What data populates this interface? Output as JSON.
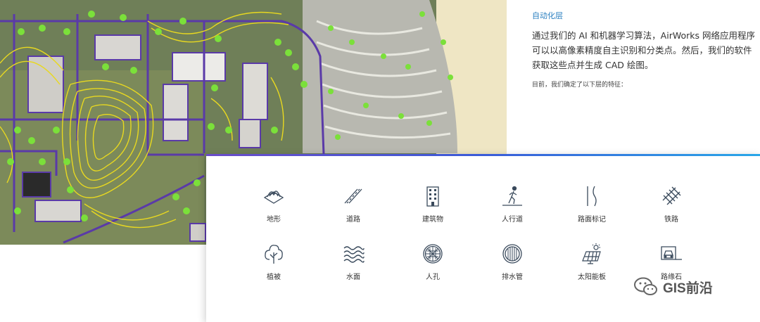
{
  "intro": {
    "tag": "自动化层",
    "body": "通过我们的 AI 和机器学习算法，AirWorks 网络应用程序可以以高像素精度自主识别和分类点。然后，我们的软件获取这些点并生成 CAD 绘图。",
    "note": "目前，我们确定了以下层的特征："
  },
  "features": [
    {
      "label": "地形",
      "icon": "terrain-icon"
    },
    {
      "label": "道路",
      "icon": "road-icon"
    },
    {
      "label": "建筑物",
      "icon": "building-icon"
    },
    {
      "label": "人行道",
      "icon": "sidewalk-icon"
    },
    {
      "label": "路面标记",
      "icon": "pavement-marking-icon"
    },
    {
      "label": "铁路",
      "icon": "railway-icon"
    },
    {
      "label": "植被",
      "icon": "vegetation-icon"
    },
    {
      "label": "水面",
      "icon": "water-icon"
    },
    {
      "label": "人孔",
      "icon": "manhole-icon"
    },
    {
      "label": "排水管",
      "icon": "drain-icon"
    },
    {
      "label": "太阳能板",
      "icon": "solar-panel-icon"
    },
    {
      "label": "路缘石",
      "icon": "curb-icon"
    }
  ],
  "watermark": {
    "text": "GIS前沿",
    "icon": "wechat-icon"
  },
  "colors": {
    "accent": "#2a7fc0",
    "icon": "#3a4a5c",
    "contour": "#e8d820",
    "tree": "#7be03a",
    "boundary": "#5a3aa8"
  }
}
